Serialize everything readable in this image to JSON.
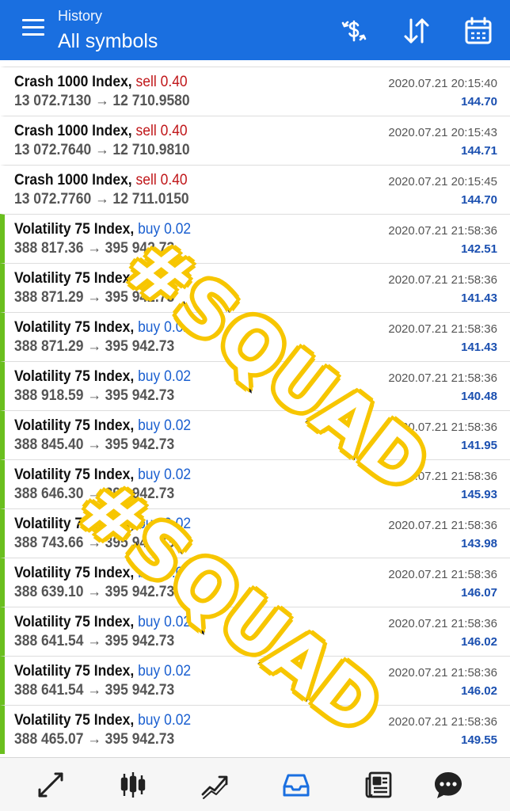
{
  "header": {
    "subtitle": "History",
    "title": "All symbols",
    "icons": [
      "menu-icon",
      "currency-exchange-icon",
      "sort-icon",
      "calendar-icon"
    ]
  },
  "trades": [
    {
      "symbol": "Crash 1000 Index,",
      "type": "sell",
      "volume": "sell 0.40",
      "prices": "13 072.7130 → 12 710.9580",
      "time": "2020.07.21 20:15:40",
      "profit": "144.70"
    },
    {
      "symbol": "Crash 1000 Index,",
      "type": "sell",
      "volume": "sell 0.40",
      "prices": "13 072.7640 → 12 710.9810",
      "time": "2020.07.21 20:15:43",
      "profit": "144.71"
    },
    {
      "symbol": "Crash 1000 Index,",
      "type": "sell",
      "volume": "sell 0.40",
      "prices": "13 072.7760 → 12 711.0150",
      "time": "2020.07.21 20:15:45",
      "profit": "144.70"
    },
    {
      "symbol": "Volatility 75 Index,",
      "type": "buy",
      "volume": "buy 0.02",
      "prices": "388 817.36 → 395 942.73",
      "time": "2020.07.21 21:58:36",
      "profit": "142.51"
    },
    {
      "symbol": "Volatility 75 Index,",
      "type": "buy",
      "volume": "buy 0.02",
      "prices": "388 871.29 → 395 942.73",
      "time": "2020.07.21 21:58:36",
      "profit": "141.43"
    },
    {
      "symbol": "Volatility 75 Index,",
      "type": "buy",
      "volume": "buy 0.02",
      "prices": "388 871.29 → 395 942.73",
      "time": "2020.07.21 21:58:36",
      "profit": "141.43"
    },
    {
      "symbol": "Volatility 75 Index,",
      "type": "buy",
      "volume": "buy 0.02",
      "prices": "388 918.59 → 395 942.73",
      "time": "2020.07.21 21:58:36",
      "profit": "140.48"
    },
    {
      "symbol": "Volatility 75 Index,",
      "type": "buy",
      "volume": "buy 0.02",
      "prices": "388 845.40 → 395 942.73",
      "time": "2020.07.21 21:58:36",
      "profit": "141.95"
    },
    {
      "symbol": "Volatility 75 Index,",
      "type": "buy",
      "volume": "buy 0.02",
      "prices": "388 646.30 → 395 942.73",
      "time": "2020.07.21 21:58:36",
      "profit": "145.93"
    },
    {
      "symbol": "Volatility 75 Index,",
      "type": "buy",
      "volume": "buy 0.02",
      "prices": "388 743.66 → 395 942.73",
      "time": "2020.07.21 21:58:36",
      "profit": "143.98"
    },
    {
      "symbol": "Volatility 75 Index,",
      "type": "buy",
      "volume": "buy 0.02",
      "prices": "388 639.10 → 395 942.73",
      "time": "2020.07.21 21:58:36",
      "profit": "146.07"
    },
    {
      "symbol": "Volatility 75 Index,",
      "type": "buy",
      "volume": "buy 0.02",
      "prices": "388 641.54 → 395 942.73",
      "time": "2020.07.21 21:58:36",
      "profit": "146.02"
    },
    {
      "symbol": "Volatility 75 Index,",
      "type": "buy",
      "volume": "buy 0.02",
      "prices": "388 641.54 → 395 942.73",
      "time": "2020.07.21 21:58:36",
      "profit": "146.02"
    },
    {
      "symbol": "Volatility 75 Index,",
      "type": "buy",
      "volume": "buy 0.02",
      "prices": "388 465.07 → 395 942.73",
      "time": "2020.07.21 21:58:36",
      "profit": "149.55"
    }
  ],
  "watermarks": [
    "#SQUAD",
    "#SQUAD"
  ],
  "bottom_nav": {
    "items": [
      "quotes-icon",
      "chart-candles-icon",
      "trade-icon",
      "history-icon",
      "news-icon",
      "chat-icon"
    ],
    "active": "history-icon"
  },
  "colors": {
    "header_bg": "#1a6fe0",
    "sell": "#c0171a",
    "buy": "#1a5fd0",
    "buy_marker": "#6abf1e",
    "profit": "#1a4fb0",
    "nav_active": "#1a6fe0",
    "nav_inactive": "#222222"
  }
}
